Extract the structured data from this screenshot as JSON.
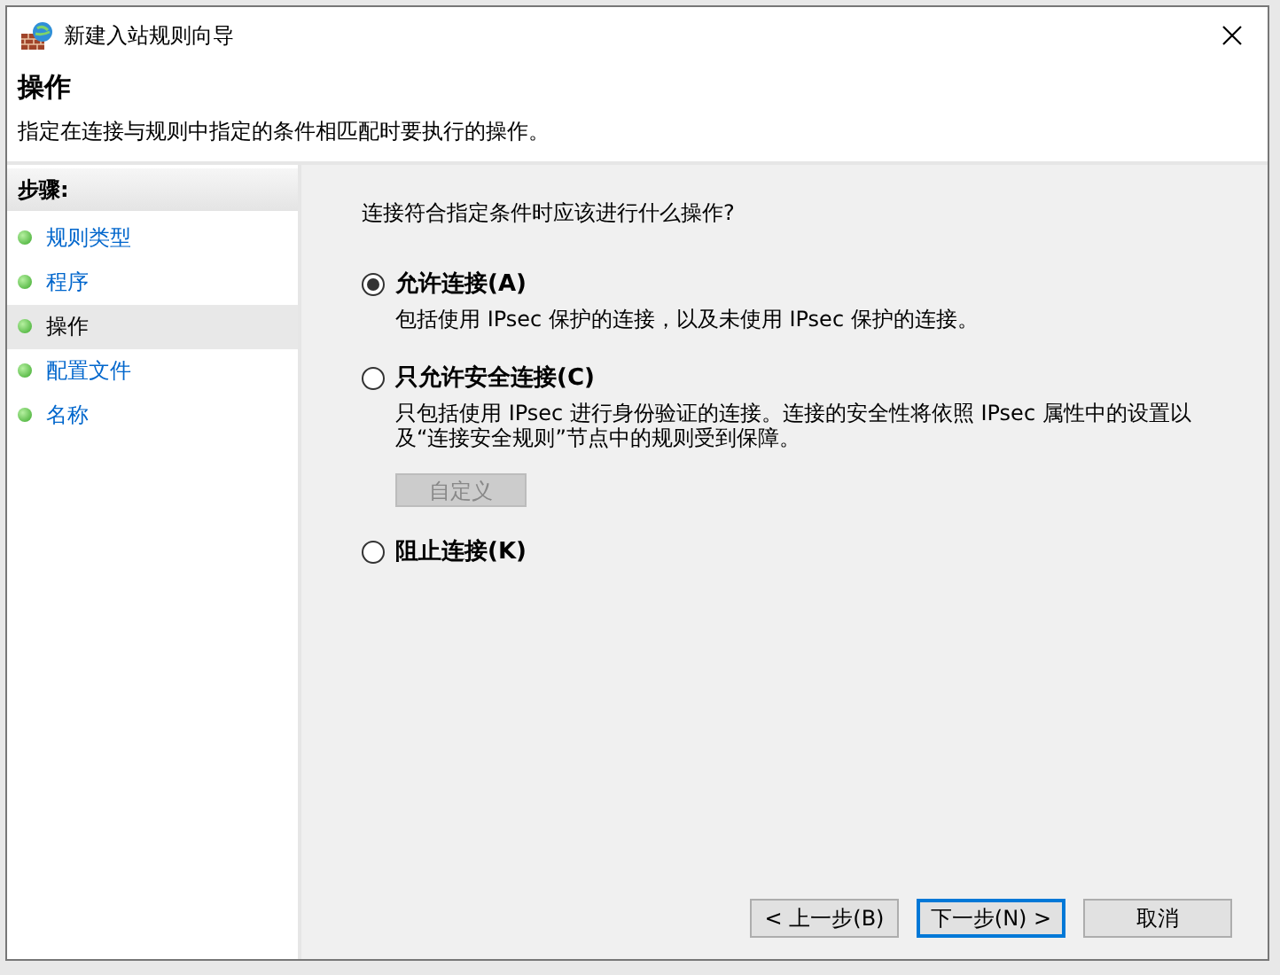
{
  "window": {
    "title": "新建入站规则向导"
  },
  "header": {
    "title": "操作",
    "subtitle": "指定在连接与规则中指定的条件相匹配时要执行的操作。"
  },
  "steps": {
    "heading": "步骤:",
    "items": [
      {
        "label": "规则类型",
        "selected": false
      },
      {
        "label": "程序",
        "selected": false
      },
      {
        "label": "操作",
        "selected": true
      },
      {
        "label": "配置文件",
        "selected": false
      },
      {
        "label": "名称",
        "selected": false
      }
    ]
  },
  "question": "连接符合指定条件时应该进行什么操作?",
  "options": [
    {
      "label": "允许连接(A)",
      "selected": true,
      "description": "包括使用 IPsec 保护的连接，以及未使用 IPsec 保护的连接。"
    },
    {
      "label": "只允许安全连接(C)",
      "selected": false,
      "description": "只包括使用 IPsec 进行身份验证的连接。连接的安全性将依照 IPsec 属性中的设置以及“连接安全规则”节点中的规则受到保障。",
      "button": {
        "label": "自定义",
        "disabled": true
      }
    },
    {
      "label": "阻止连接(K)",
      "selected": false
    }
  ],
  "buttons": [
    {
      "label": "< 上一步(B)",
      "default": false
    },
    {
      "label": "下一步(N) >",
      "default": true
    },
    {
      "label": "取消",
      "default": false
    }
  ]
}
